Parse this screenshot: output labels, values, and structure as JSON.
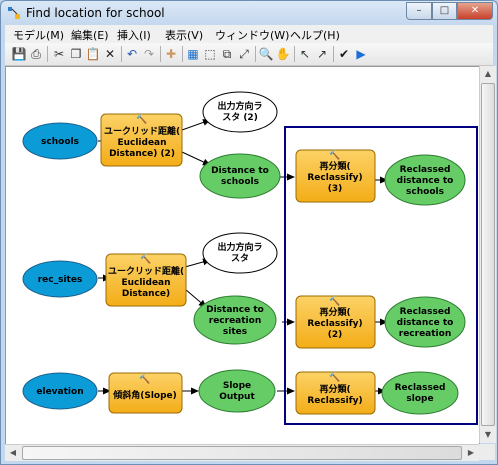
{
  "window": {
    "title": "Find location for school"
  },
  "menubar": [
    "モデル(M)",
    "編集(E)",
    "挿入(I)",
    "表示(V)",
    "ウィンドウ(W)",
    "ヘルプ(H)"
  ],
  "colors": {
    "input": "#0b9bd7",
    "tool": "#f7b520",
    "output": "#66cc66",
    "derived": "#ffffff",
    "selection": "#000080"
  },
  "model": {
    "inputs": {
      "schools": "schools",
      "rec_sites": "rec_sites",
      "elevation": "elevation"
    },
    "tools": {
      "euclid2": [
        "ユークリッド距離(",
        "Euclidean",
        "Distance) (2)"
      ],
      "euclid1": [
        "ユークリッド距離(",
        "Euclidean",
        "Distance)"
      ],
      "slope": [
        "傾斜角(Slope)"
      ],
      "reclass3": [
        "再分類(",
        "Reclassify)",
        "(3)"
      ],
      "reclass2": [
        "再分類(",
        "Reclassify)",
        "(2)"
      ],
      "reclass1": [
        "再分類(",
        "Reclassify)"
      ]
    },
    "derived": {
      "outdir2": [
        "出力方向ラ",
        "スタ (2)"
      ],
      "outdir1": [
        "出力方向ラ",
        "スタ"
      ]
    },
    "outputs": {
      "dist_schools": [
        "Distance to",
        "schools"
      ],
      "dist_rec": [
        "Distance to",
        "recreation",
        "sites"
      ],
      "slope_out": [
        "Slope",
        "Output"
      ],
      "recl_schools": [
        "Reclassed",
        "distance to",
        "schools"
      ],
      "recl_rec": [
        "Reclassed",
        "distance to",
        "recreation"
      ],
      "recl_slope": [
        "Reclassed",
        "slope"
      ]
    }
  }
}
